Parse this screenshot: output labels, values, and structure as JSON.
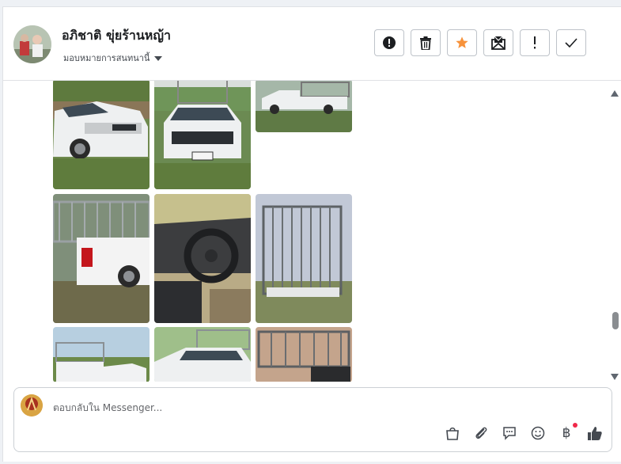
{
  "header": {
    "contact_name": "อภิชาติ ขุ่ยร้านหญ้า",
    "assign_label": "มอบหมายการสนทนานี้"
  },
  "toolbar": {
    "buttons": [
      "alert-icon",
      "trash-icon",
      "star-icon",
      "mail-icon",
      "exclamation-icon",
      "check-icon"
    ],
    "star_color": "#f7923b"
  },
  "gallery": {
    "photos": [
      "pickup-front",
      "pickup-front-plate",
      "pickup-side",
      "pickup-rear-cage",
      "pickup-interior",
      "pickup-cage-rear",
      "pickup-side-cage",
      "pickup-front-cage",
      "pickup-cage-top"
    ]
  },
  "reply": {
    "placeholder": "ตอบกลับใน Messenger...",
    "icons": [
      "bag-icon",
      "attach-icon",
      "chat-icon",
      "emoji-icon",
      "baht-icon",
      "like-icon"
    ],
    "baht_symbol": "฿"
  }
}
